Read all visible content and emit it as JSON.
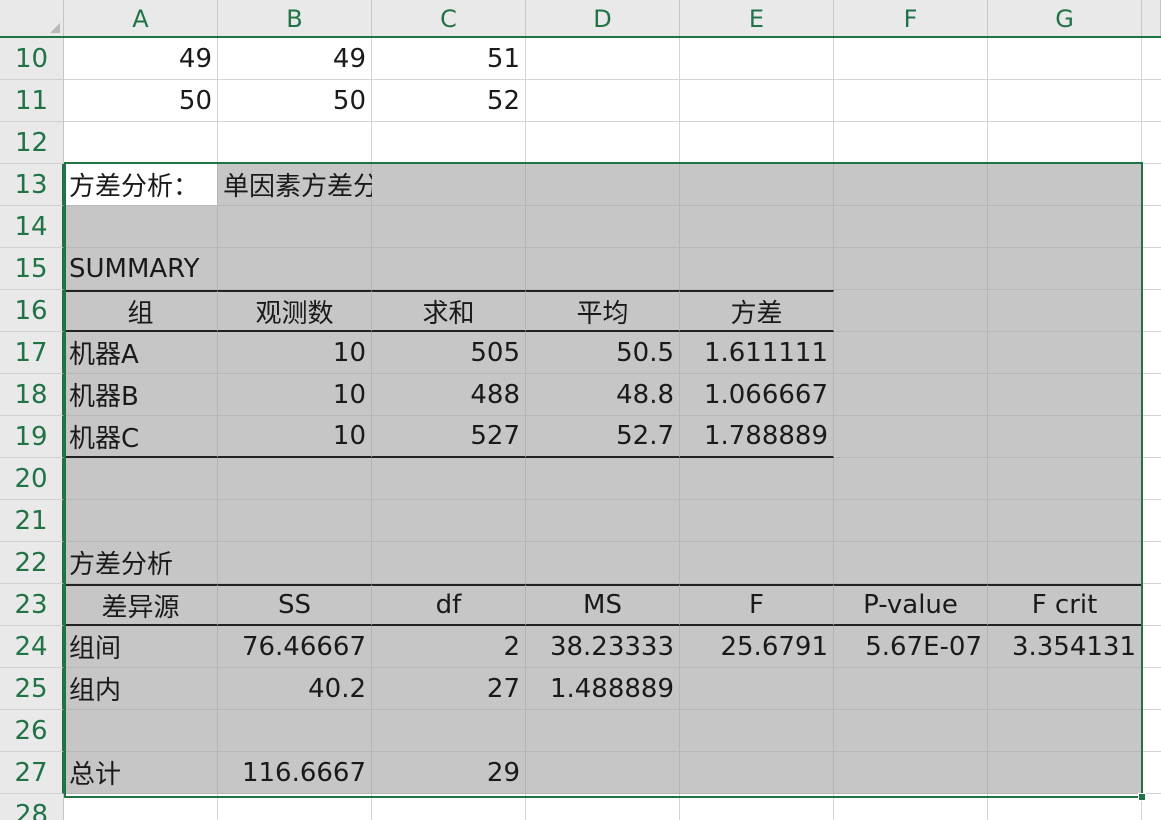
{
  "columns": [
    "A",
    "B",
    "C",
    "D",
    "E",
    "F",
    "G"
  ],
  "rows": [
    {
      "num": "10",
      "cells": [
        "49",
        "49",
        "51",
        "",
        "",
        "",
        ""
      ]
    },
    {
      "num": "11",
      "cells": [
        "50",
        "50",
        "52",
        "",
        "",
        "",
        ""
      ]
    },
    {
      "num": "12",
      "cells": [
        "",
        "",
        "",
        "",
        "",
        "",
        ""
      ]
    },
    {
      "num": "13",
      "cells": [
        "方差分析：",
        "单因素方差分析",
        "",
        "",
        "",
        "",
        ""
      ]
    },
    {
      "num": "14",
      "cells": [
        "",
        "",
        "",
        "",
        "",
        "",
        ""
      ]
    },
    {
      "num": "15",
      "cells": [
        "SUMMARY",
        "",
        "",
        "",
        "",
        "",
        ""
      ]
    },
    {
      "num": "16",
      "cells": [
        "组",
        "观测数",
        "求和",
        "平均",
        "方差",
        "",
        ""
      ]
    },
    {
      "num": "17",
      "cells": [
        "机器A",
        "10",
        "505",
        "50.5",
        "1.611111",
        "",
        ""
      ]
    },
    {
      "num": "18",
      "cells": [
        "机器B",
        "10",
        "488",
        "48.8",
        "1.066667",
        "",
        ""
      ]
    },
    {
      "num": "19",
      "cells": [
        "机器C",
        "10",
        "527",
        "52.7",
        "1.788889",
        "",
        ""
      ]
    },
    {
      "num": "20",
      "cells": [
        "",
        "",
        "",
        "",
        "",
        "",
        ""
      ]
    },
    {
      "num": "21",
      "cells": [
        "",
        "",
        "",
        "",
        "",
        "",
        ""
      ]
    },
    {
      "num": "22",
      "cells": [
        "方差分析",
        "",
        "",
        "",
        "",
        "",
        ""
      ]
    },
    {
      "num": "23",
      "cells": [
        "差异源",
        "SS",
        "df",
        "MS",
        "F",
        "P-value",
        "F crit"
      ]
    },
    {
      "num": "24",
      "cells": [
        "组间",
        "76.46667",
        "2",
        "38.23333",
        "25.6791",
        "5.67E-07",
        "3.354131"
      ]
    },
    {
      "num": "25",
      "cells": [
        "组内",
        "40.2",
        "27",
        "1.488889",
        "",
        "",
        ""
      ]
    },
    {
      "num": "26",
      "cells": [
        "",
        "",
        "",
        "",
        "",
        "",
        ""
      ]
    },
    {
      "num": "27",
      "cells": [
        "总计",
        "116.6667",
        "29",
        "",
        "",
        "",
        ""
      ]
    },
    {
      "num": "28",
      "cells": [
        "",
        "",
        "",
        "",
        "",
        "",
        ""
      ]
    }
  ],
  "colors": {
    "accent": "#217346",
    "selection_fill": "#c6c6c6",
    "header_bg": "#e9e9e9"
  }
}
